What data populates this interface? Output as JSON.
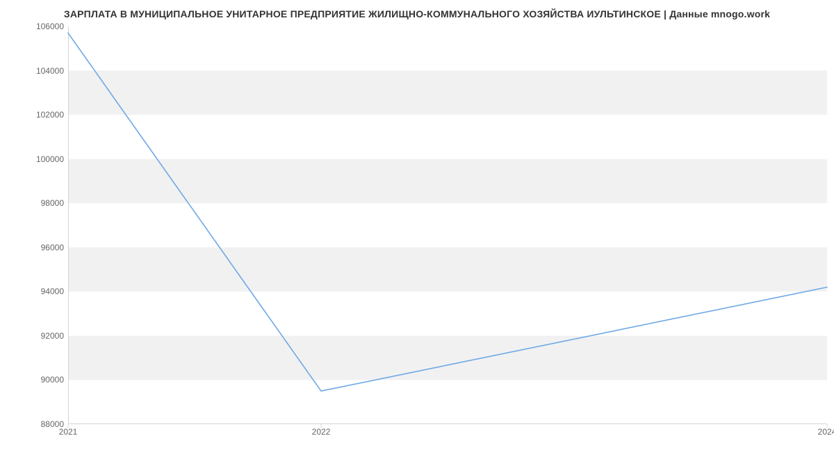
{
  "chart_data": {
    "type": "line",
    "title": "ЗАРПЛАТА В МУНИЦИПАЛЬНОЕ УНИТАРНОЕ ПРЕДПРИЯТИЕ ЖИЛИЩНО-КОММУНАЛЬНОГО ХОЗЯЙСТВА ИУЛЬТИНСКОЕ | Данные mnogo.work",
    "xlabel": "",
    "ylabel": "",
    "x": [
      2021,
      2022,
      2024
    ],
    "values": [
      105700,
      89500,
      94200
    ],
    "xlim": [
      2021,
      2024
    ],
    "ylim": [
      88000,
      106000
    ],
    "y_ticks": [
      88000,
      90000,
      92000,
      94000,
      96000,
      98000,
      100000,
      102000,
      104000,
      106000
    ],
    "x_ticks": [
      2021,
      2022,
      2024
    ],
    "line_color": "#6ea8e6",
    "band_color": "#f1f1f1"
  }
}
